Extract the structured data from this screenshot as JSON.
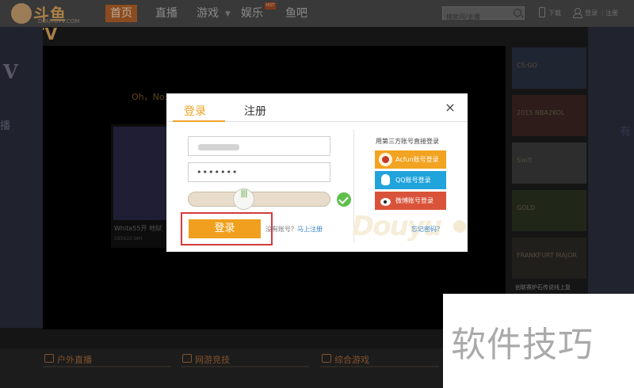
{
  "header": {
    "brand": "斗鱼TV",
    "brand_sub": "DOUYUTV.COM",
    "nav": [
      "首页",
      "直播",
      "游戏",
      "娱乐",
      "鱼吧"
    ],
    "hot_badge": "HOT",
    "search_placeholder": "搜房间/主播",
    "download": "下载",
    "login": "登录",
    "register": "注册",
    "separator": "|"
  },
  "background": {
    "player_message": "Oh，No...",
    "left_letter": "V",
    "left_char": "播",
    "right_char": "有",
    "thumb_caption": "White55开 地狱",
    "thumb_meta": "185610  WH",
    "side_cards": [
      "CS:GO",
      "2015 NBA2KOL",
      "Swift",
      "GOLD",
      "FRANKFURT MAJOR"
    ],
    "side_caption": "创联赛炉石传说线上复",
    "categories": [
      "户外直播",
      "网游竞技",
      "综合游戏"
    ]
  },
  "modal": {
    "tab_login": "登录",
    "tab_register": "注册",
    "close": "×",
    "password_mask": "•••••••",
    "slider_grip": "|||",
    "login_button": "登录",
    "no_account": "没有账号？",
    "register_now": "马上注册",
    "third_party_title": "用第三方账号直接登录",
    "acfun_login": "Acfun账号登录",
    "qq_login": "QQ账号登录",
    "weibo_login": "微博账号登录",
    "forgot_password": "忘记密码？",
    "brand_mark": "Douyu"
  },
  "watermark": {
    "text": "软件技巧"
  },
  "colors": {
    "accent_orange": "#f0a01e",
    "qq_blue": "#21a3dc",
    "weibo_red": "#d9533a",
    "highlight_red": "#d23c3c",
    "link_blue": "#3b84c9"
  }
}
